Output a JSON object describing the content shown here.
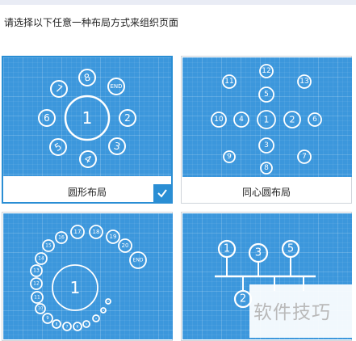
{
  "header": {
    "instruction": "请选择以下任意一种布局方式来组织页面"
  },
  "layouts": [
    {
      "label": "圆形布局",
      "selected": true,
      "nodes": [
        {
          "t": "1"
        },
        {
          "t": "8"
        },
        {
          "t": "END"
        },
        {
          "t": "2"
        },
        {
          "t": "3"
        },
        {
          "t": "4"
        },
        {
          "t": "5"
        },
        {
          "t": "6"
        },
        {
          "t": "7"
        }
      ]
    },
    {
      "label": "同心圆布局",
      "selected": false,
      "nodes": [
        {
          "t": "1"
        },
        {
          "t": "12"
        },
        {
          "t": "11"
        },
        {
          "t": "13"
        },
        {
          "t": "5"
        },
        {
          "t": "10"
        },
        {
          "t": "4"
        },
        {
          "t": "2"
        },
        {
          "t": "6"
        },
        {
          "t": "3"
        },
        {
          "t": "9"
        },
        {
          "t": "7"
        },
        {
          "t": "8"
        }
      ]
    },
    {
      "label": "",
      "selected": false,
      "nodes": [
        {
          "t": "1"
        },
        {
          "t": "17"
        },
        {
          "t": "18"
        },
        {
          "t": "19"
        },
        {
          "t": "20"
        },
        {
          "t": "END"
        },
        {
          "t": "16"
        },
        {
          "t": "15"
        },
        {
          "t": "14"
        },
        {
          "t": "13"
        },
        {
          "t": "12"
        },
        {
          "t": "11"
        },
        {
          "t": "10"
        },
        {
          "t": "9"
        },
        {
          "t": "8"
        },
        {
          "t": "7"
        },
        {
          "t": "6"
        },
        {
          "t": "5"
        },
        {
          "t": "4"
        },
        {
          "t": "3"
        },
        {
          "t": "2"
        }
      ]
    },
    {
      "label": "",
      "selected": false,
      "nodes": [
        {
          "t": "1"
        },
        {
          "t": "3"
        },
        {
          "t": "5"
        },
        {
          "t": "2"
        }
      ]
    }
  ],
  "check_icon": "check-icon",
  "watermark": {
    "text": "软件技巧"
  }
}
